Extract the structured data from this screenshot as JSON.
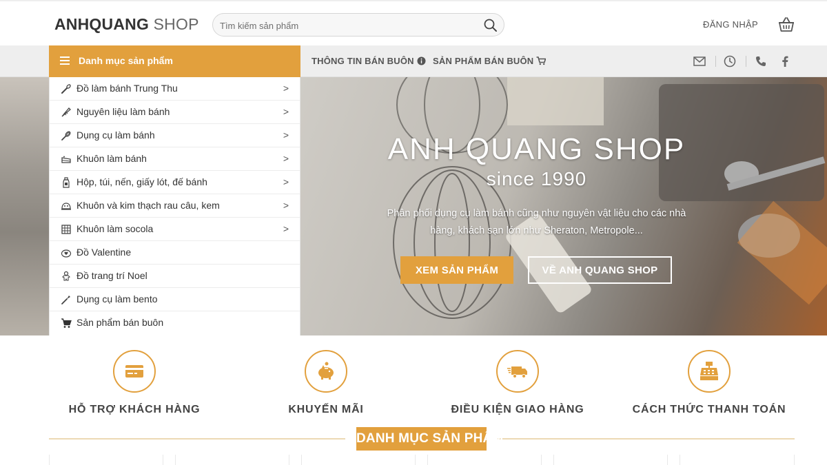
{
  "header": {
    "logo_bold": "ANHQUANG",
    "logo_light": " SHOP",
    "search_placeholder": "Tìm kiếm sản phẩm",
    "login_label": "ĐĂNG NHẬP"
  },
  "navbar": {
    "category_title": "Danh mục sản phẩm",
    "links": [
      "THÔNG TIN BÁN BUÔN",
      "SẢN PHẨM BÁN BUÔN"
    ]
  },
  "categories": [
    {
      "label": "Đồ làm bánh Trung Thu",
      "icon": "whisk-icon",
      "has_submenu": true
    },
    {
      "label": "Nguyên liệu làm bánh",
      "icon": "pastry-bag-icon",
      "has_submenu": true
    },
    {
      "label": "Dụng cụ làm bánh",
      "icon": "whisk-icon",
      "has_submenu": true
    },
    {
      "label": "Khuôn làm bánh",
      "icon": "cake-icon",
      "has_submenu": true
    },
    {
      "label": "Hộp, túi, nến, giấy lót, đế bánh",
      "icon": "bottle-icon",
      "has_submenu": true
    },
    {
      "label": "Khuôn và kim thạch rau câu, kem",
      "icon": "jelly-mold-icon",
      "has_submenu": true
    },
    {
      "label": "Khuôn làm socola",
      "icon": "chocolate-icon",
      "has_submenu": true
    },
    {
      "label": "Đồ Valentine",
      "icon": "heart-box-icon",
      "has_submenu": false
    },
    {
      "label": "Đồ trang trí Noel",
      "icon": "gingerbread-icon",
      "has_submenu": false
    },
    {
      "label": "Dụng cụ làm bento",
      "icon": "spatula-icon",
      "has_submenu": false
    },
    {
      "label": "Sản phẩm bán buôn",
      "icon": "cart-icon",
      "has_submenu": false
    }
  ],
  "submenu_arrow": ">",
  "hero": {
    "title": "ANH QUANG SHOP",
    "subtitle": "since 1990",
    "description": "Phân phối dụng cụ làm bánh cũng như nguyên vật liệu cho các nhà hàng, khách sạn lớn như Sheraton, Metropole...",
    "primary_button": "XEM SẢN PHẨM",
    "secondary_button": "VỀ ANH QUANG SHOP"
  },
  "features": [
    {
      "label": "HỖ TRỢ KHÁCH HÀNG",
      "icon": "credit-card-icon"
    },
    {
      "label": "KHUYẾN MÃI",
      "icon": "piggy-bank-icon"
    },
    {
      "label": "ĐIỀU KIỆN GIAO HÀNG",
      "icon": "delivery-truck-icon"
    },
    {
      "label": "CÁCH THỨC THANH TOÁN",
      "icon": "cash-register-icon"
    }
  ],
  "section_title": "DANH MỤC SẢN PHẨM",
  "colors": {
    "accent": "#e2a03d",
    "navbar_bg": "#eeeeee",
    "text": "#333333"
  }
}
